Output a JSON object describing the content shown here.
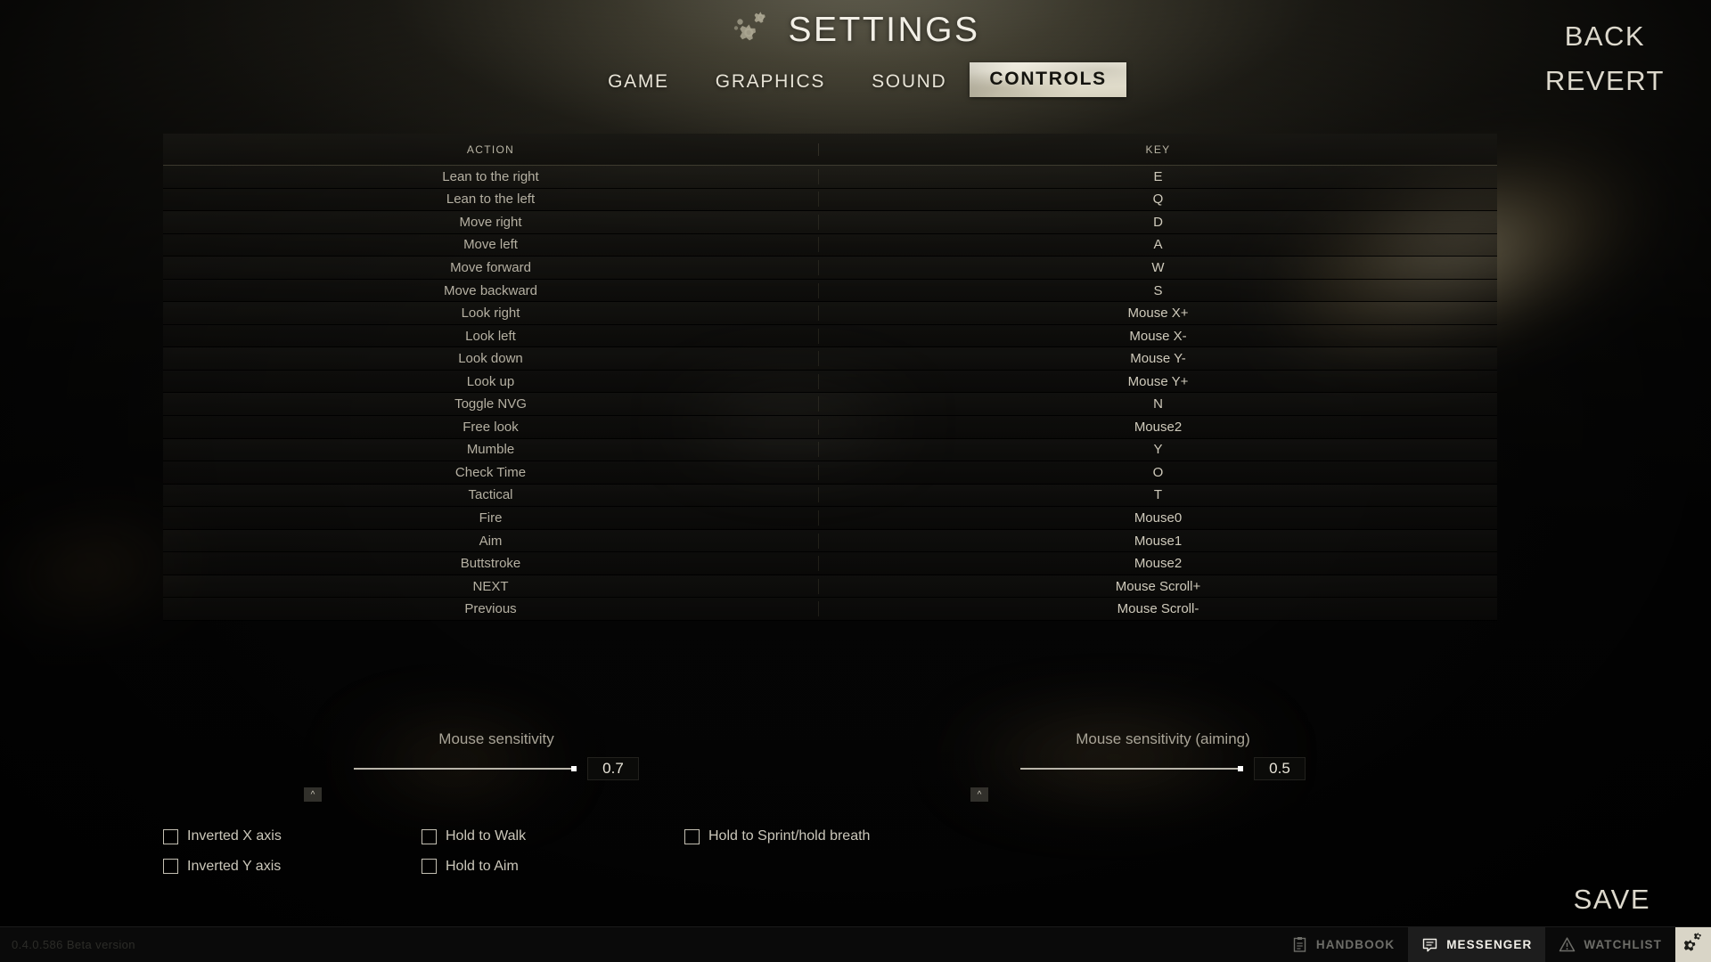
{
  "header": {
    "title": "SETTINGS",
    "gears_icon": "gears-icon",
    "tabs": [
      {
        "label": "GAME",
        "active": false
      },
      {
        "label": "GRAPHICS",
        "active": false
      },
      {
        "label": "SOUND",
        "active": false
      },
      {
        "label": "CONTROLS",
        "active": true
      }
    ],
    "back_label": "BACK",
    "revert_label": "REVERT"
  },
  "table": {
    "columns": [
      "ACTION",
      "KEY"
    ],
    "rows": [
      {
        "action": "Lean to the right",
        "key": "E"
      },
      {
        "action": "Lean to the left",
        "key": "Q"
      },
      {
        "action": "Move right",
        "key": "D"
      },
      {
        "action": "Move left",
        "key": "A"
      },
      {
        "action": "Move forward",
        "key": "W"
      },
      {
        "action": "Move backward",
        "key": "S"
      },
      {
        "action": "Look right",
        "key": "Mouse X+"
      },
      {
        "action": "Look left",
        "key": "Mouse X-"
      },
      {
        "action": "Look down",
        "key": "Mouse Y-"
      },
      {
        "action": "Look up",
        "key": "Mouse Y+"
      },
      {
        "action": "Toggle NVG",
        "key": "N"
      },
      {
        "action": "Free look",
        "key": "Mouse2"
      },
      {
        "action": "Mumble",
        "key": "Y"
      },
      {
        "action": "Check Time",
        "key": "O"
      },
      {
        "action": "Tactical",
        "key": "T"
      },
      {
        "action": "Fire",
        "key": "Mouse0"
      },
      {
        "action": "Aim",
        "key": "Mouse1"
      },
      {
        "action": "Buttstroke",
        "key": "Mouse2"
      },
      {
        "action": "NEXT",
        "key": "Mouse Scroll+"
      },
      {
        "action": "Previous",
        "key": "Mouse Scroll-"
      }
    ],
    "scroll_thumb_top_pct": 6,
    "scroll_thumb_height_pct": 40
  },
  "sliders": [
    {
      "label": "Mouse sensitivity",
      "value": "0.7",
      "knob_pct": 100,
      "caret_glyph": "^"
    },
    {
      "label": "Mouse sensitivity (aiming)",
      "value": "0.5",
      "knob_pct": 100,
      "caret_glyph": "^"
    }
  ],
  "checkboxes": [
    {
      "label": "Inverted X axis",
      "checked": false
    },
    {
      "label": "Hold to Walk",
      "checked": false
    },
    {
      "label": "Hold to Sprint/hold breath",
      "checked": false
    },
    {
      "label": "Inverted Y axis",
      "checked": false
    },
    {
      "label": "Hold to Aim",
      "checked": false
    }
  ],
  "save_label": "SAVE",
  "bottom_bar": {
    "version": "0.4.0.586 Beta version",
    "taskbar": [
      {
        "label": "HANDBOOK",
        "icon": "clipboard-icon",
        "active": false
      },
      {
        "label": "MESSENGER",
        "icon": "chat-bubble-icon",
        "active": true
      },
      {
        "label": "WATCHLIST",
        "icon": "warning-triangle-icon",
        "active": false
      }
    ],
    "settings_button_icon": "gears-icon"
  },
  "colors": {
    "accent_tape": "#e4e0d0",
    "text_primary": "#cbc7ba",
    "text_muted": "#6d6d68",
    "scrollbar": "#c6cbcb",
    "glow": "#cec8aa"
  }
}
